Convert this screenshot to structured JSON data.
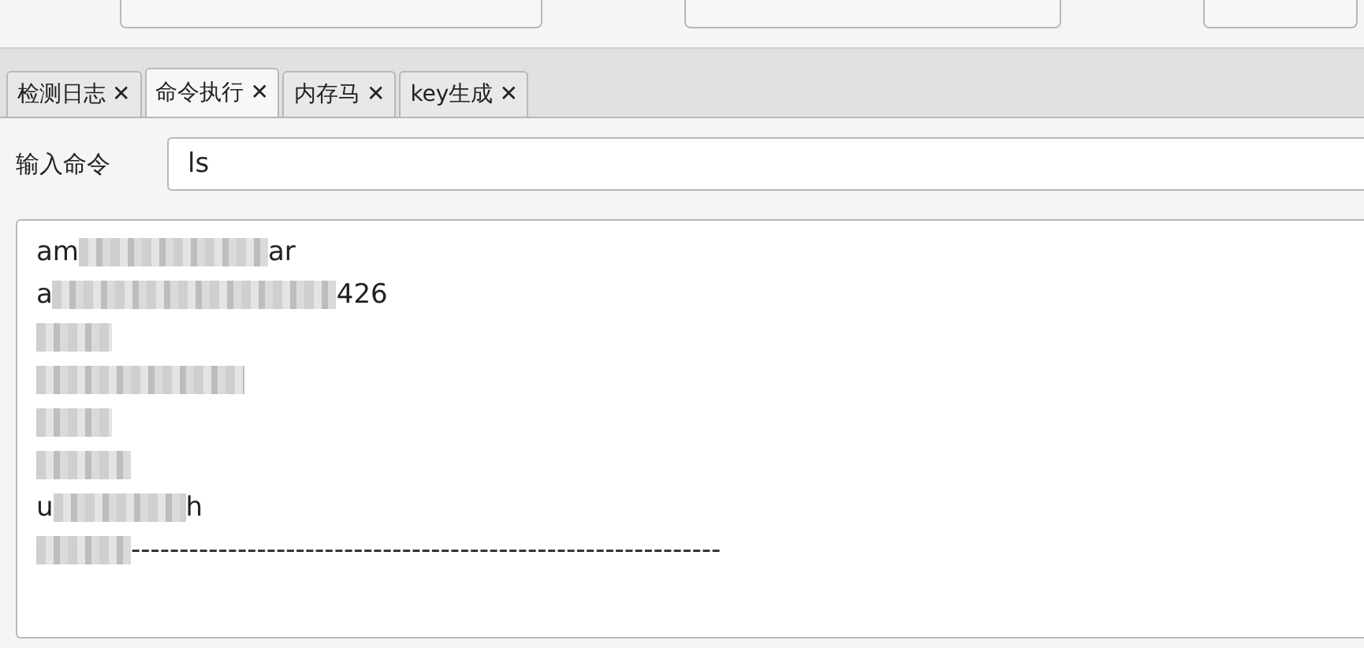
{
  "tabs": [
    {
      "label": "检测日志",
      "close": "✕",
      "selected": false
    },
    {
      "label": "命令执行",
      "close": "✕",
      "selected": true
    },
    {
      "label": "内存马",
      "close": "✕",
      "selected": false
    },
    {
      "label": "key生成",
      "close": "✕",
      "selected": false
    }
  ],
  "command": {
    "label": "输入命令",
    "value": "ls"
  },
  "output": [
    {
      "kind": "masked",
      "before": "am",
      "after": "ar"
    },
    {
      "kind": "masked",
      "before": "a",
      "after": "426"
    },
    {
      "kind": "masked"
    },
    {
      "kind": "masked"
    },
    {
      "kind": "masked"
    },
    {
      "kind": "masked"
    },
    {
      "kind": "masked",
      "before": "u",
      "after": "h"
    },
    {
      "kind": "masked",
      "after": "-------------------------------------------------------------"
    }
  ]
}
